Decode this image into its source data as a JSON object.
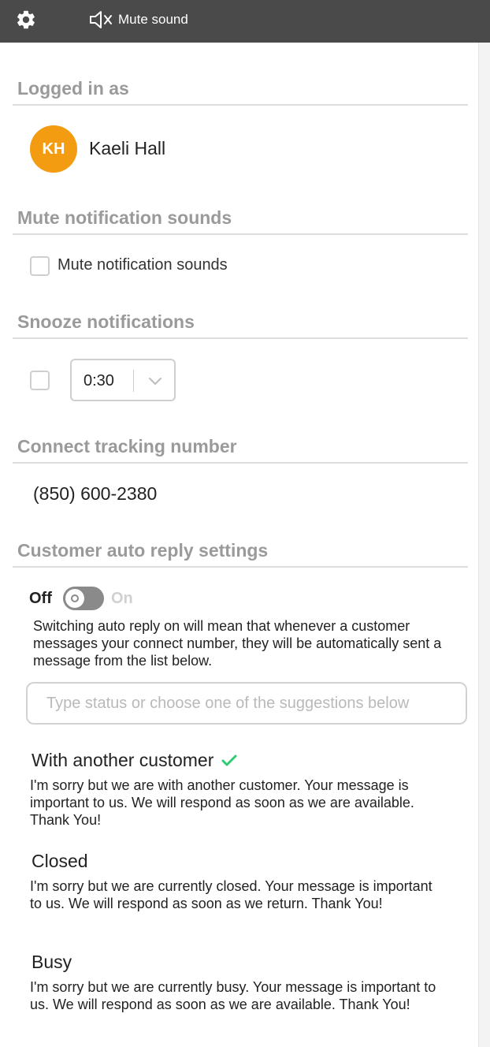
{
  "header": {
    "settings_icon": "gear-icon",
    "mute_icon": "speaker-muted-icon",
    "mute_label": "Mute sound"
  },
  "sections": {
    "logged_in": {
      "title": "Logged in as",
      "initials": "KH",
      "name": "Kaeli Hall"
    },
    "mute": {
      "title": "Mute notification sounds",
      "checkbox_label": "Mute notification sounds",
      "checked": false
    },
    "snooze": {
      "title": "Snooze notifications",
      "checked": false,
      "duration": "0:30"
    },
    "tracking": {
      "title": "Connect tracking number",
      "phone": "(850) 600-2380"
    },
    "auto_reply": {
      "title": "Customer auto reply settings",
      "toggle_off_label": "Off",
      "toggle_on_label": "On",
      "enabled": false,
      "description": "Switching auto reply on will mean that whenever a customer messages your connect number, they will be automatically sent a message from the list below.",
      "input_placeholder": "Type status or choose one of the suggestions below",
      "suggestions": [
        {
          "title": "With another customer",
          "selected": true,
          "body": "I'm sorry but we are with another customer. Your message is important to us. We will respond as soon as we are available. Thank You!"
        },
        {
          "title": "Closed",
          "selected": false,
          "body": "I'm sorry but we are currently closed. Your message is important to us. We will respond as soon as we return. Thank You!"
        },
        {
          "title": "Busy",
          "selected": false,
          "body": "I'm sorry but we are currently busy. Your message is important to us. We will respond as soon as we are available. Thank You!"
        }
      ]
    }
  },
  "colors": {
    "header_bg": "#4a4a4a",
    "avatar_bg": "#f39c12",
    "section_title": "#9a9a9a",
    "checkmark": "#2ecc71"
  }
}
